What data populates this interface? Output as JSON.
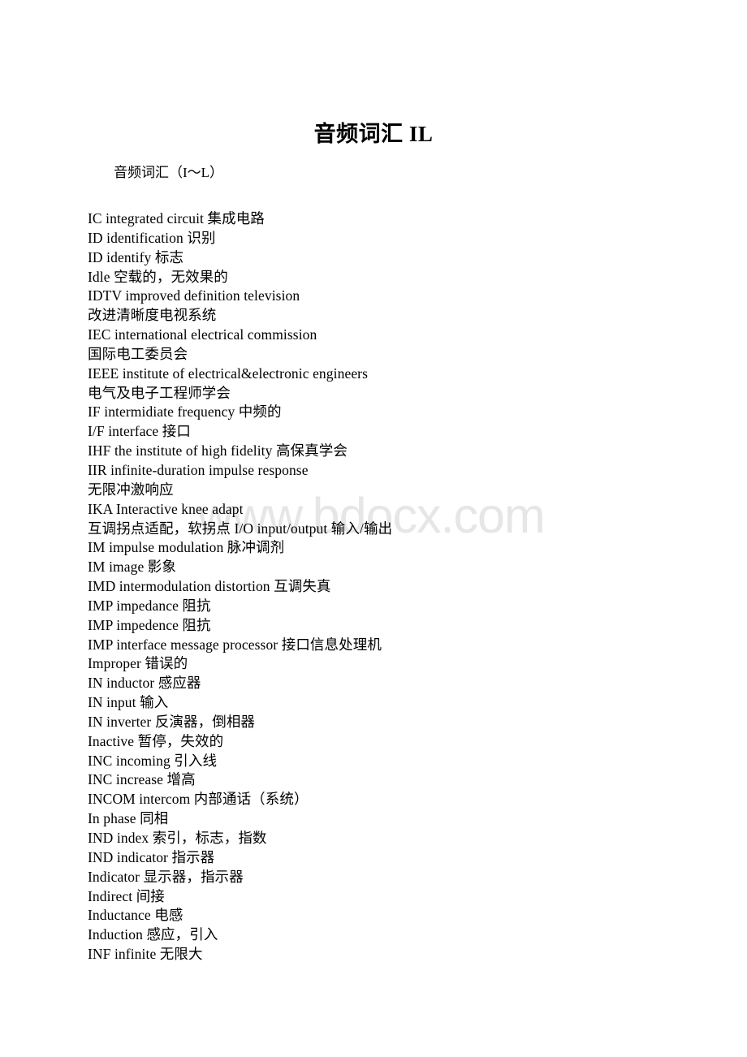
{
  "document": {
    "title": "音频词汇 IL",
    "subtitle": "音频词汇（I～L）",
    "watermark": "www.bdocx.com",
    "watermark_color": "#e6e6e6",
    "text_color": "#000000",
    "background_color": "#ffffff",
    "lines": [
      "IC integrated circuit 集成电路",
      "ID identification 识别",
      "ID identify 标志",
      "Idle 空载的，无效果的",
      "IDTV improved definition television",
      "改进清晰度电视系统",
      "IEC international electrical commission",
      "国际电工委员会",
      "IEEE institute of electrical&electronic engineers",
      "电气及电子工程师学会",
      "IF intermidiate frequency 中频的",
      "I/F interface 接口",
      "IHF the institute of high fidelity 高保真学会",
      "IIR infinite-duration impulse response",
      "无限冲激响应",
      "IKA Interactive knee adapt",
      "互调拐点适配，软拐点 I/O input/output 输入/输出",
      "IM impulse modulation 脉冲调剂",
      "IM image 影象",
      "IMD intermodulation distortion 互调失真",
      "IMP impedance 阻抗",
      "IMP impedence 阻抗",
      "IMP interface message processor 接口信息处理机",
      "Improper 错误的",
      "IN inductor 感应器",
      "IN input 输入",
      "IN inverter 反演器，倒相器",
      "Inactive 暂停，失效的",
      "INC incoming 引入线",
      "INC increase 增高",
      "INCOM intercom 内部通话（系统）",
      "In phase 同相",
      "IND index 索引，标志，指数",
      "IND indicator 指示器",
      "Indicator 显示器，指示器",
      "Indirect 间接",
      "Inductance 电感",
      "Induction 感应，引入",
      "INF infinite 无限大"
    ]
  }
}
